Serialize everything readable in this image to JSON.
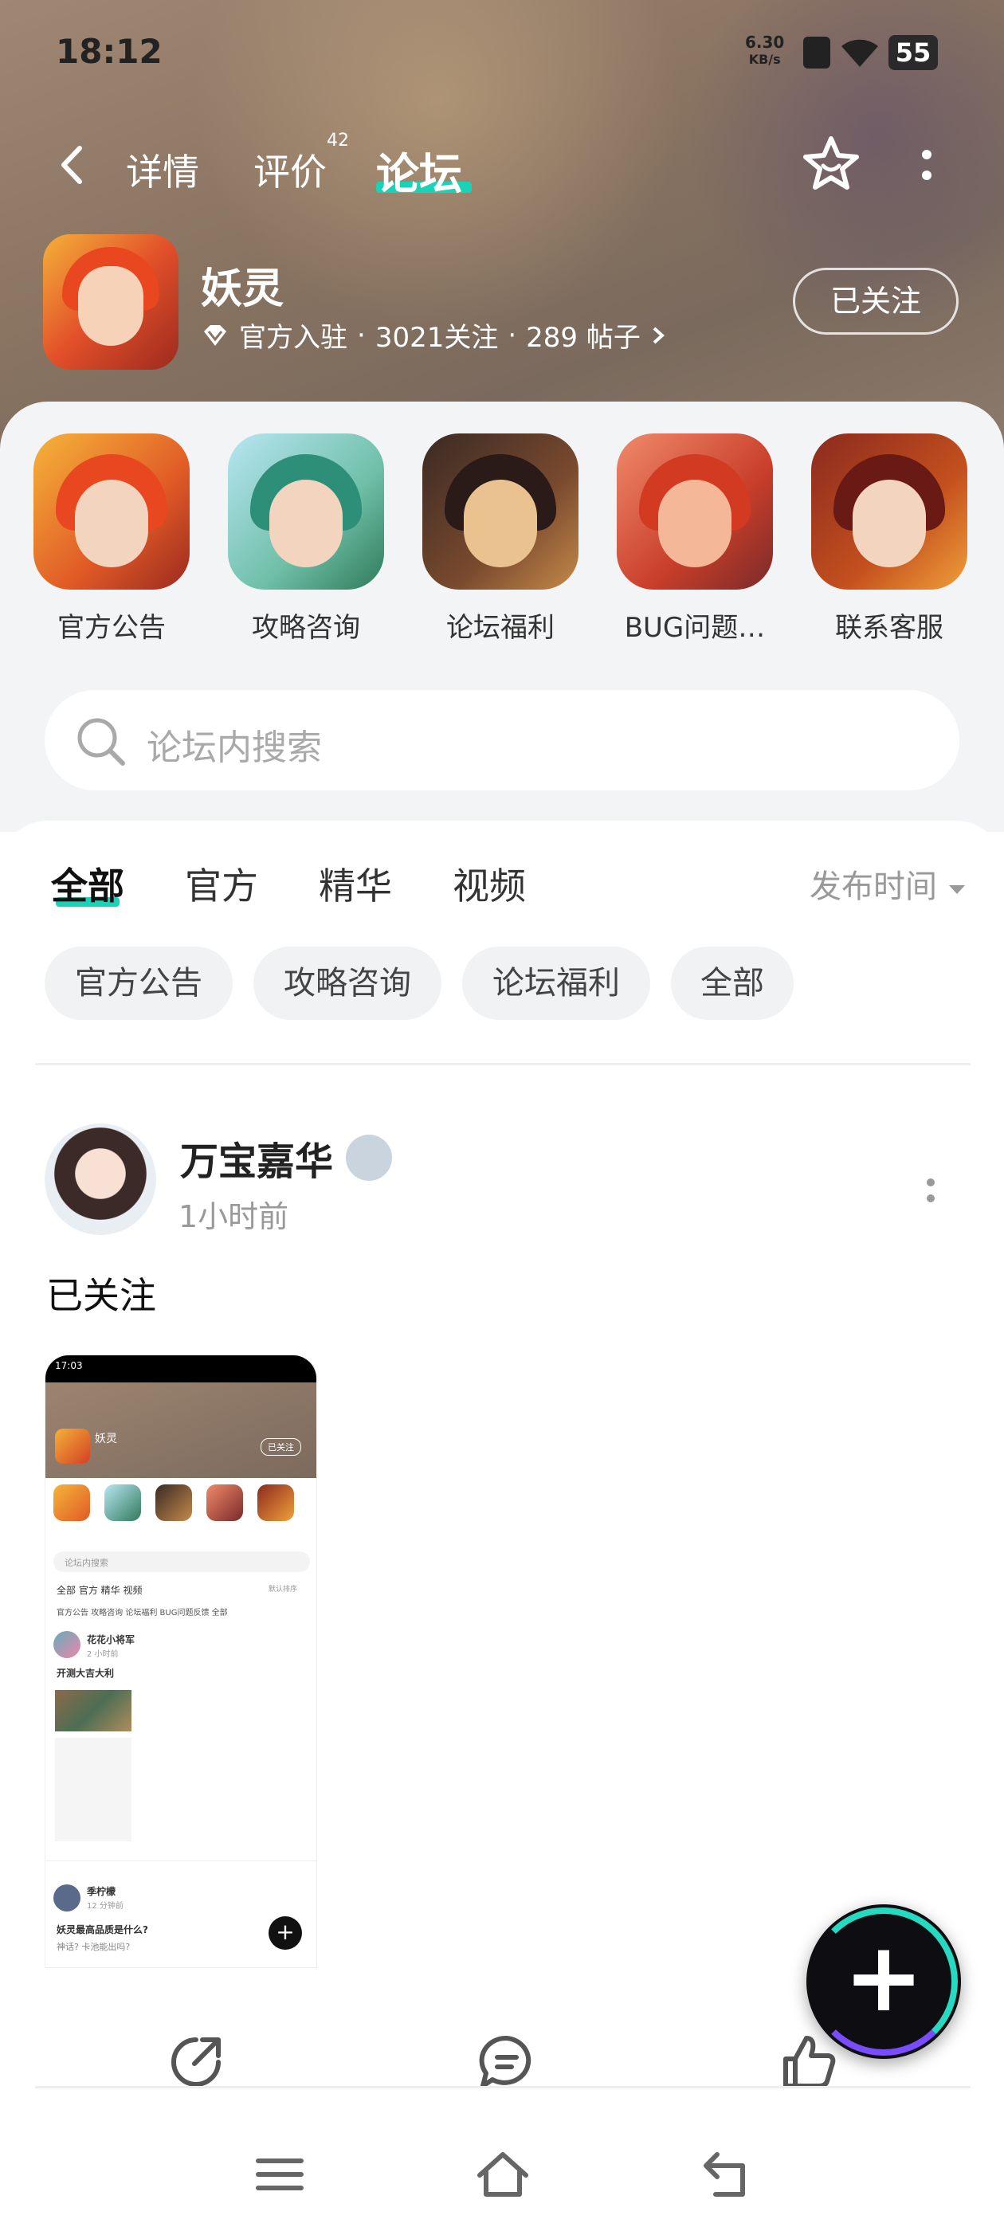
{
  "status_bar": {
    "time": "18:12",
    "net_speed": "6.30",
    "net_unit": "KB/s",
    "battery": "55"
  },
  "header": {
    "tabs": [
      {
        "label": "详情"
      },
      {
        "label": "评价"
      },
      {
        "label": "论坛"
      }
    ],
    "review_count": "42",
    "active_tab": "论坛"
  },
  "game": {
    "name": "妖灵",
    "official": "官方入驻",
    "follows": "3021关注",
    "posts": "289 帖子",
    "follow_button": "已关注"
  },
  "categories": [
    {
      "label": "官方公告"
    },
    {
      "label": "攻略咨询"
    },
    {
      "label": "论坛福利"
    },
    {
      "label": "BUG问题…"
    },
    {
      "label": "联系客服"
    }
  ],
  "search": {
    "placeholder": "论坛内搜索"
  },
  "feed_tabs": [
    {
      "label": "全部"
    },
    {
      "label": "官方"
    },
    {
      "label": "精华"
    },
    {
      "label": "视频"
    }
  ],
  "sort": {
    "label": "发布时间"
  },
  "chips": [
    {
      "label": "官方公告"
    },
    {
      "label": "攻略咨询"
    },
    {
      "label": "论坛福利"
    },
    {
      "label": "全部"
    }
  ],
  "post": {
    "author": "万宝嘉华",
    "time": "1小时前",
    "text": "已关注",
    "screenshot": {
      "time": "17:03",
      "game_name": "妖灵",
      "follow": "已关注",
      "search": "论坛内搜索",
      "tabs": "全部  官方  精华  视频",
      "sort": "默认排序",
      "chips": "官方公告  攻略咨询  论坛福利  BUG问题反馈  全部",
      "author": "花花小将军",
      "time_ago": "2 小时前",
      "text": "开测大吉大利",
      "author2": "季柠檬",
      "time_ago2": "12 分钟前",
      "text2": "妖灵最高品质是什么?",
      "text3": "神话? 卡池能出吗?"
    }
  },
  "colors": {
    "accent": "#19d3b8",
    "hero": "#8a7462",
    "panel": "#f3f4f6"
  }
}
